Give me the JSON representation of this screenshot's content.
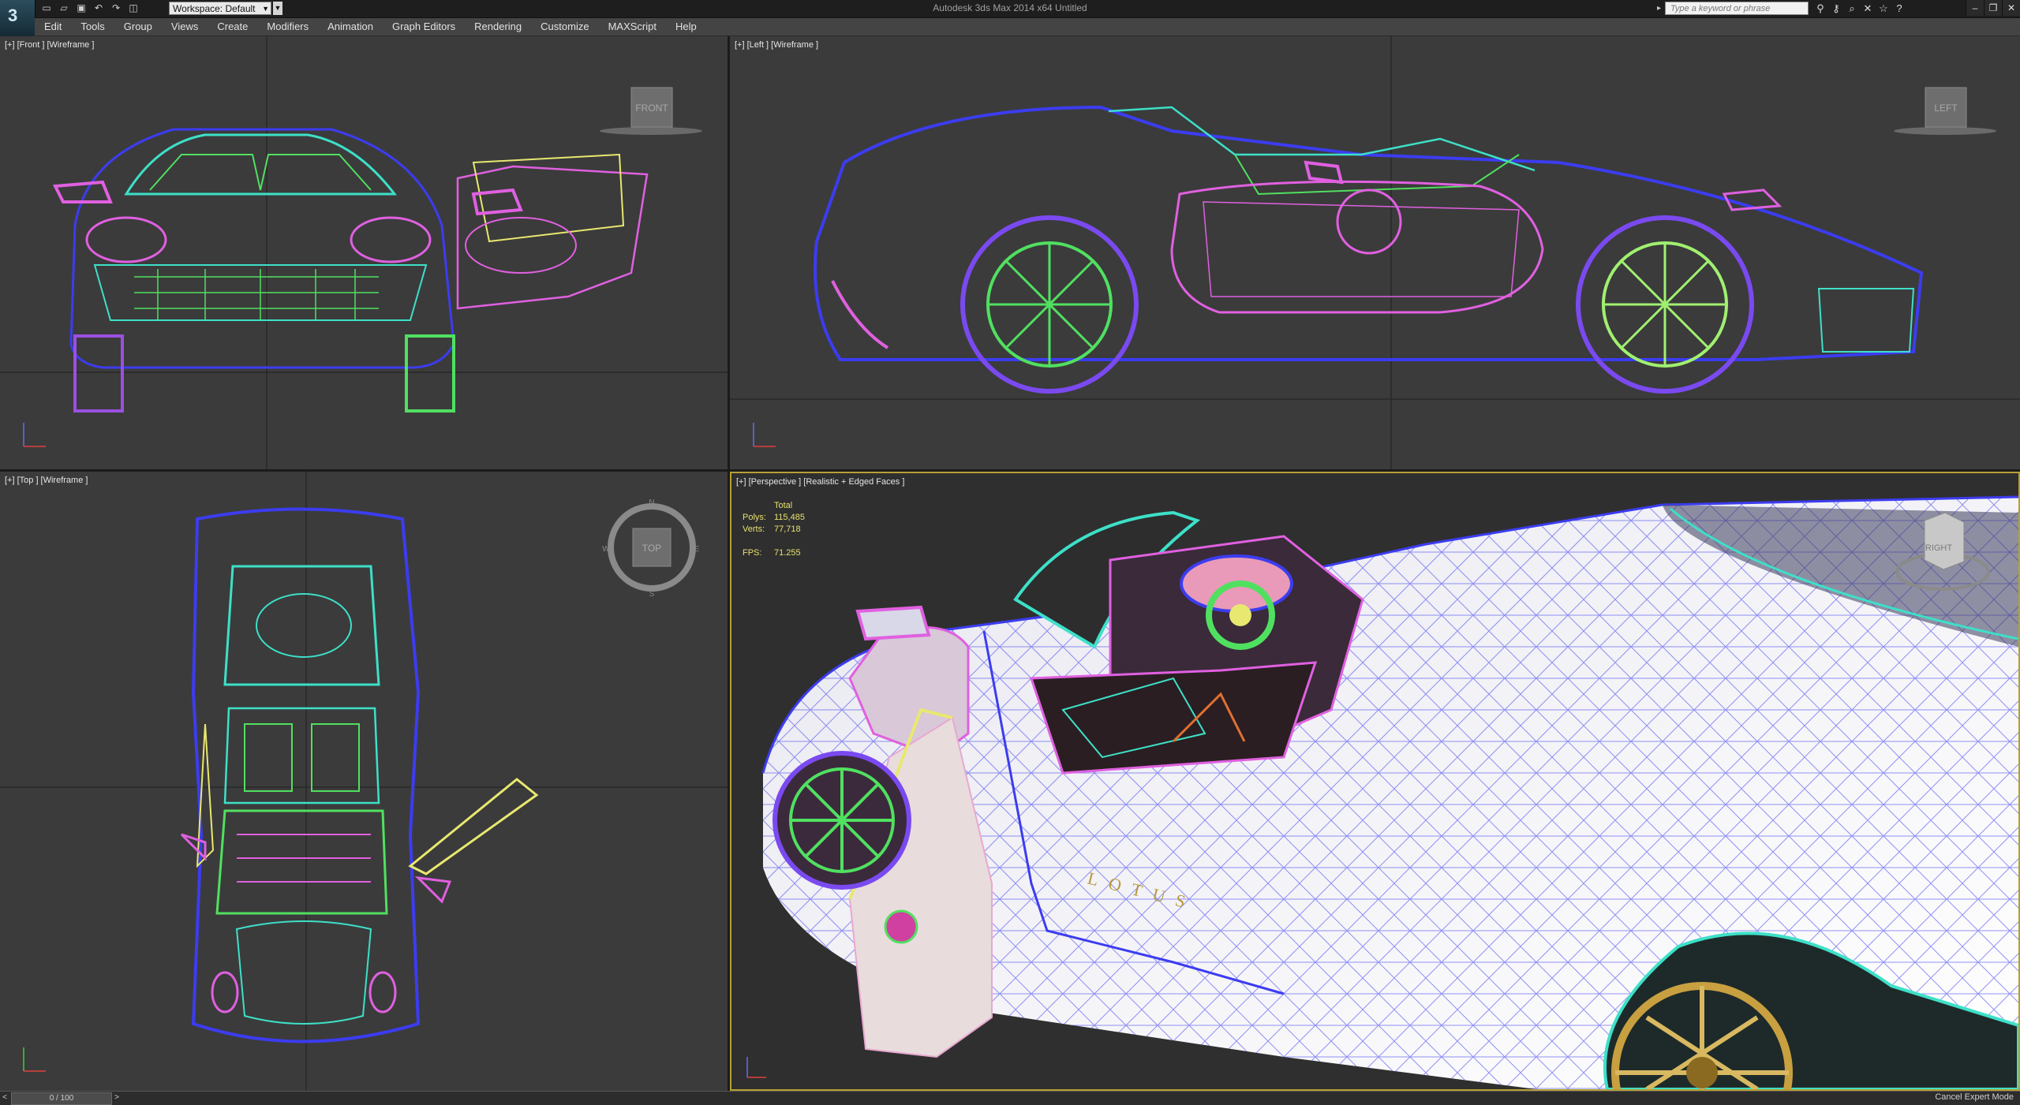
{
  "app": {
    "title": "Autodesk 3ds Max  2014 x64     Untitled",
    "logo_letter": "3",
    "workspace": "Workspace: Default",
    "search_placeholder": "Type a keyword or phrase"
  },
  "menu": [
    "Edit",
    "Tools",
    "Group",
    "Views",
    "Create",
    "Modifiers",
    "Animation",
    "Graph Editors",
    "Rendering",
    "Customize",
    "MAXScript",
    "Help"
  ],
  "viewports": {
    "front": {
      "label": "[+] [Front ] [Wireframe ]",
      "cube": "FRONT"
    },
    "left": {
      "label": "[+] [Left ] [Wireframe ]",
      "cube": "LEFT"
    },
    "top": {
      "label": "[+] [Top ] [Wireframe ]",
      "cube": "TOP",
      "compass": [
        "N",
        "E",
        "S",
        "W"
      ]
    },
    "perspective": {
      "label": "[+] [Perspective ] [Realistic + Edged Faces ]",
      "cube": "RIGHT",
      "brand": "LOTUS"
    }
  },
  "stats": {
    "header": "Total",
    "polys_label": "Polys:",
    "polys": "115,485",
    "verts_label": "Verts:",
    "verts": "77,718",
    "fps_label": "FPS:",
    "fps": "71.255"
  },
  "status": {
    "time_slider": "0 / 100",
    "prev": "<",
    "next": ">",
    "mode": "Cancel Expert Mode"
  },
  "colors": {
    "viewport_bg": "#3b3b3b",
    "active_border": "#b8a033",
    "wire_blue": "#3c3cf0",
    "wire_cyan": "#3de0c8",
    "wire_pink": "#e060e0",
    "wire_green": "#50e060",
    "wire_yellow": "#e8e870"
  }
}
